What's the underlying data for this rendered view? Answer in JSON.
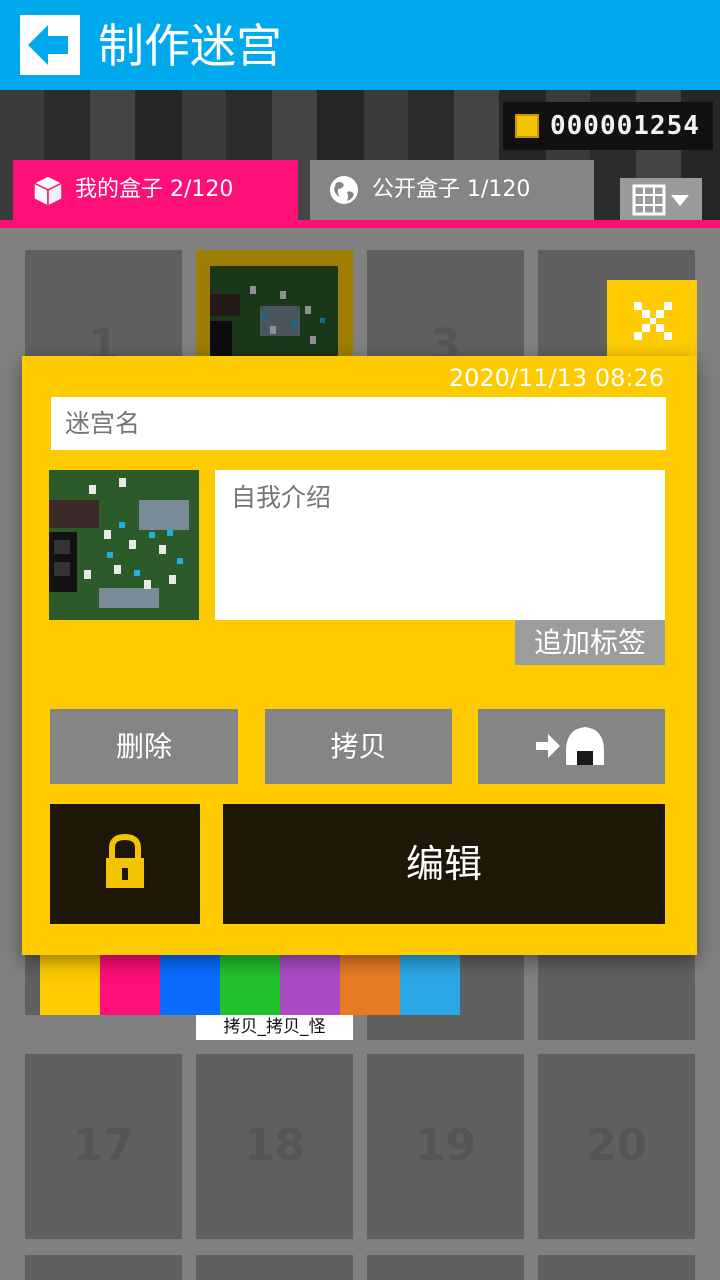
{
  "header": {
    "title": "制作迷宫",
    "back_icon": "arrow-left-icon"
  },
  "coins": {
    "value": "000001254",
    "icon": "coin-icon"
  },
  "tabs": {
    "mine": {
      "label": "我的盒子 2/120",
      "icon": "cube-icon"
    },
    "public": {
      "label": "公开盒子 1/120",
      "icon": "globe-icon"
    },
    "view_toggle": {
      "icon": "grid-view-dropdown-icon"
    }
  },
  "grid": {
    "cell_numbers_visible": [
      "1",
      "3",
      "17",
      "18",
      "19",
      "20"
    ]
  },
  "dialog": {
    "date": "2020/11/13 08:26",
    "name_placeholder": "迷宫名",
    "intro_placeholder": "自我介绍",
    "add_tag_label": "追加标签",
    "delete_label": "删除",
    "copy_label": "拷贝",
    "export_icon": "send-to-onigiri-icon",
    "lock_icon": "padlock-icon",
    "edit_label": "编辑",
    "close_icon": "close-x-icon"
  },
  "palette": {
    "colors": [
      "#fdcb00",
      "#ff0f78",
      "#0a6cff",
      "#22c12e",
      "#aa4bc4",
      "#e57c23",
      "#2aa8e6"
    ]
  },
  "maze_label": "拷贝_拷贝_怪"
}
